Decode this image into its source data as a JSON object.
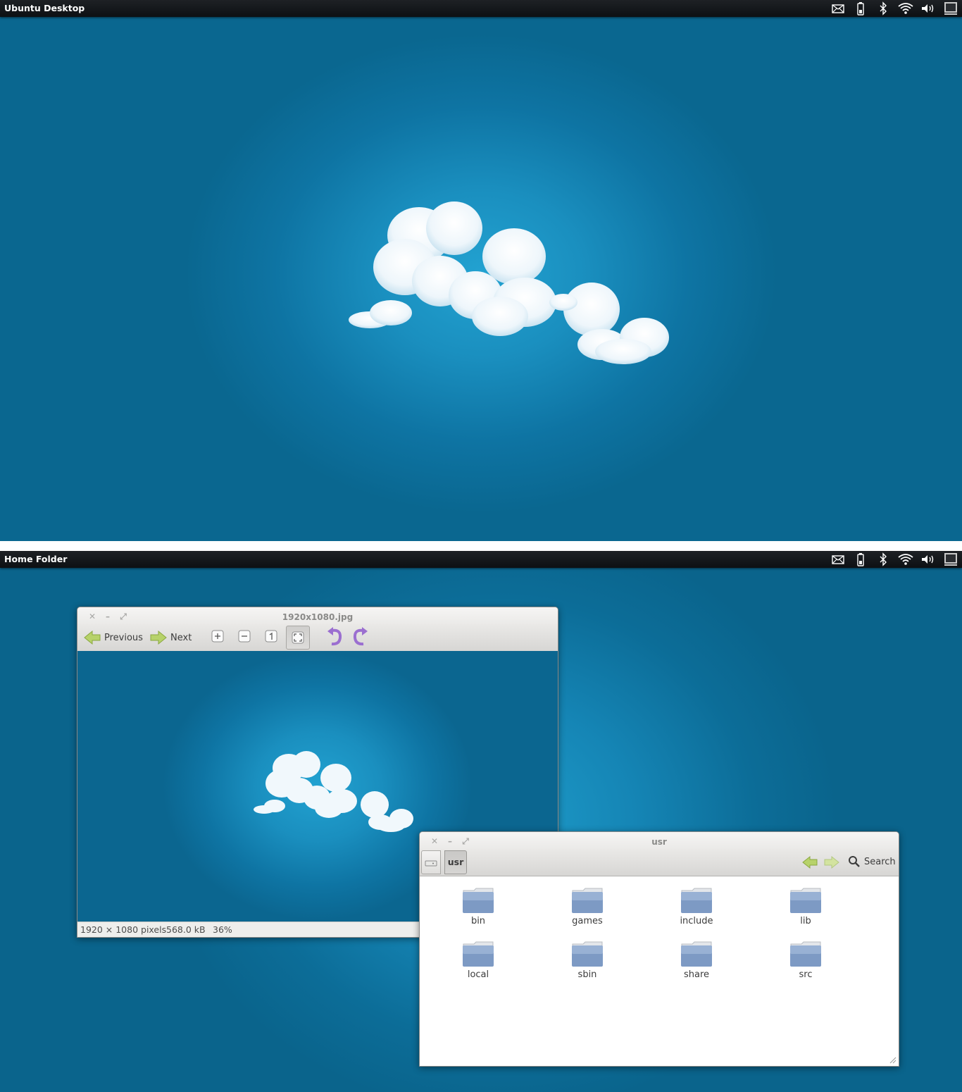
{
  "top_screen": {
    "panel": {
      "title": "Ubuntu Desktop",
      "tray_icons": [
        "mail-icon",
        "battery-icon",
        "bluetooth-icon",
        "wifi-icon",
        "volume-icon",
        "session-icon"
      ]
    }
  },
  "bottom_screen": {
    "panel": {
      "title": "Home Folder",
      "tray_icons": [
        "mail-icon",
        "battery-icon",
        "bluetooth-icon",
        "wifi-icon",
        "volume-icon",
        "session-icon"
      ]
    },
    "image_viewer": {
      "title": "1920x1080.jpg",
      "toolbar": {
        "previous_label": "Previous",
        "next_label": "Next",
        "buttons": [
          "zoom-in-icon",
          "zoom-out-icon",
          "normal-size-icon",
          "best-fit-icon",
          "rotate-left-icon",
          "rotate-right-icon"
        ]
      },
      "status": {
        "dimensions": "1920 × 1080 pixels",
        "size": "568.0 kB",
        "zoom": "36%"
      }
    },
    "file_manager": {
      "title": "usr",
      "breadcrumb": {
        "current": "usr"
      },
      "search_label": "Search",
      "folders": [
        "bin",
        "games",
        "include",
        "lib",
        "local",
        "sbin",
        "share",
        "src"
      ]
    }
  },
  "colors": {
    "desktop_center": "#22a2d1",
    "desktop_edge": "#0a6790",
    "panel": "#15181b",
    "window_chrome": "#e8e7e5"
  }
}
